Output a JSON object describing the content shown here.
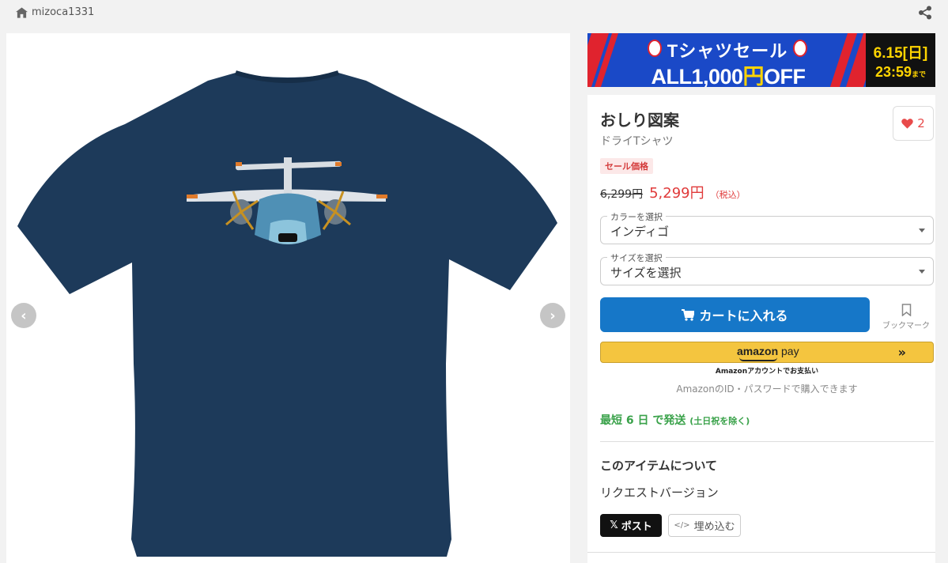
{
  "shop": {
    "name": "mizoca1331",
    "icon": "house-icon"
  },
  "banner": {
    "title": "Tシャツセール",
    "offer_prefix": "ALL1,000",
    "offer_yen": "円",
    "offer_suffix": "OFF",
    "deadline_date": "6.15[日]",
    "deadline_time": "23:59",
    "deadline_suffix": "まで",
    "colors": {
      "blue": "#1a49c7",
      "red": "#e0232e",
      "yellow": "#ffd400"
    }
  },
  "product": {
    "title": "おしり図案",
    "type": "ドライTシャツ",
    "favorite_count": "2",
    "sale_badge": "セール価格",
    "original_price": "6,299円",
    "price": "5,299円",
    "tax_note": "（税込）",
    "shirt_color_hex": "#1d3a5a"
  },
  "options": {
    "color": {
      "label": "カラーを選択",
      "value": "インディゴ"
    },
    "size": {
      "label": "サイズを選択",
      "value": "サイズを選択"
    }
  },
  "actions": {
    "add_to_cart": "カートに入れる",
    "bookmark": "ブックマーク",
    "amazon_logo": "amazon",
    "amazon_pay": "pay",
    "amazon_note": "Amazonアカウントでお支払い",
    "amazon_id_note": "AmazonのID・パスワードで購入できます"
  },
  "shipping": {
    "text": "最短 6 日 で発送",
    "note": "(土日祝を除く)"
  },
  "about": {
    "heading": "このアイテムについて",
    "description": "リクエストバージョン"
  },
  "social": {
    "post": "ポスト",
    "embed": "埋め込む"
  },
  "gallery": {
    "prev": "‹",
    "next": "›"
  }
}
